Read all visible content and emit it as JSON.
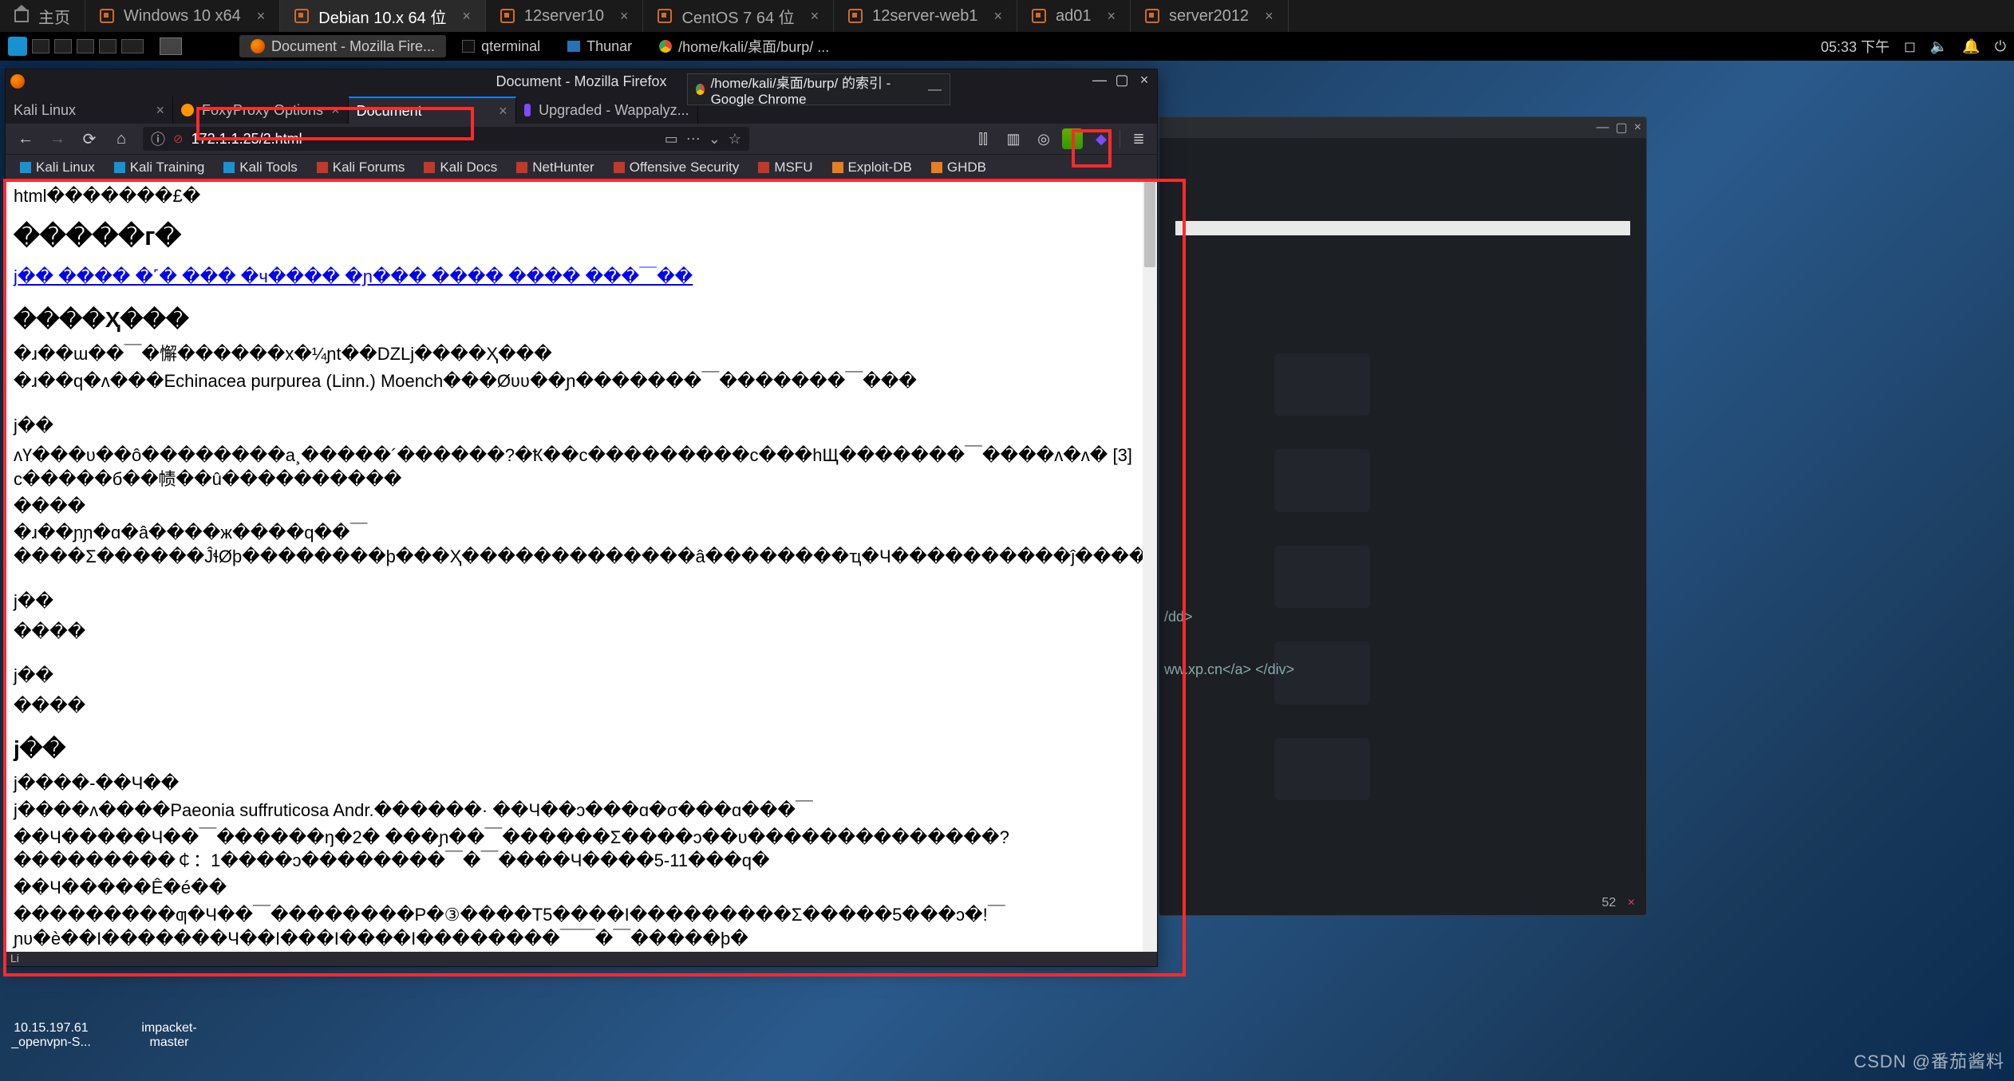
{
  "vm_tabs": {
    "home": "主页",
    "items": [
      {
        "label": "Windows 10 x64"
      },
      {
        "label": "Debian 10.x 64 位",
        "active": true
      },
      {
        "label": "12server10"
      },
      {
        "label": "CentOS 7 64 位"
      },
      {
        "label": "12server-web1"
      },
      {
        "label": "ad01"
      },
      {
        "label": "server2012"
      }
    ]
  },
  "kali_bar": {
    "apps": [
      {
        "label": "Document - Mozilla Fire...",
        "active": true,
        "icon": "firefox"
      },
      {
        "label": "qterminal",
        "icon": "terminal"
      },
      {
        "label": "Thunar",
        "icon": "files"
      },
      {
        "label": "/home/kali/桌面/burp/ ...",
        "icon": "chrome"
      }
    ],
    "clock": "05:33 下午"
  },
  "firefox": {
    "title": "Document - Mozilla Firefox",
    "tabs": [
      {
        "label": "Kali Linux"
      },
      {
        "label": "FoxyProxy Options",
        "icon": "fp"
      },
      {
        "label": "Document",
        "active": true
      },
      {
        "label": "Upgraded - Wappalyz...",
        "icon": "wapp"
      }
    ],
    "url_protocol_hint": "ⓘ",
    "url": "172.1.1.25/2.html",
    "bookmarks": [
      {
        "label": "Kali Linux",
        "cls": "bic-kali"
      },
      {
        "label": "Kali Training",
        "cls": "bic-kt"
      },
      {
        "label": "Kali Tools",
        "cls": "bic-kt"
      },
      {
        "label": "Kali Forums",
        "cls": "bic-fs"
      },
      {
        "label": "Kali Docs",
        "cls": "bic-kd"
      },
      {
        "label": "NetHunter",
        "cls": "bic-nh"
      },
      {
        "label": "Offensive Security",
        "cls": "bic-off"
      },
      {
        "label": "MSFU",
        "cls": "bic-msf"
      },
      {
        "label": "Exploit-DB",
        "cls": "bic-edb"
      },
      {
        "label": "GHDB",
        "cls": "bic-gh"
      }
    ],
    "status_char": "Li"
  },
  "chrome_overlay": {
    "title": "/home/kali/桌面/burp/ 的索引 - Google Chrome"
  },
  "page": {
    "line1": "html�������£�",
    "h1": "�����г�",
    "link": "j�� ���� �˹� ��� �ч���� �ɲ��� ���� ���� ���￣��",
    "h2a": "����Ҳ���",
    "p2": "�ɹ��ɯ��￣�懈������x�¼ɲt��DZLj����Ҳ���",
    "p3": "�ɹ��q�ʌ���Echinacea purpurea (Linn.) Moench���Øʋʋ��ɲ�������￣�������￣���",
    "blk1_a": "j��",
    "blk1_b": "ʌҮ���ʋ��ô��������a¸�����´������?�Ҟ��c���������c���hЩ�������￣����ʌ�ʌ� [3] c�����б��帻��û����������",
    "blk1_c": "����",
    "blk2": "�ɹ��ɲɲ�ɑ�â����ж����q��￣����Ʃ������ĴɬØþ��������þ���Ҳ�������������â��������ҵ�Ч����������ĵ������Σ�бô�",
    "blk3_a": "j��",
    "blk3_b": "����",
    "blk4_a": "j��",
    "blk4_b": "����",
    "h2c": "j��",
    "p5": "j����-��Ч��",
    "p6": "j����ʌ����Paeonia suffruticosa Andr.������· ��Ч��ɔ���ɑ�σ���ɑ���￣",
    "p7": "��Ч�����Ч��￣������ŋ�2� ���ɲ��￣������Σ����ɔ��ʋ��������������?���������￠：1����ɔ��������￣�￣����Ч����5-11���q�",
    "p8": "��Ч�����Ê�é��",
    "p9": "���������ƣ�Ч��￣��������Ρ�③����T5����І���������Σ�����5���ɔ�!￣ ɲʋ�è��І�������Ч��Ι���Ι����Ι��������￣￣�￣�����þ�"
  },
  "bg_window": {
    "snippet1": "/dd>",
    "snippet2": "ww.xp.cn</a> </div>",
    "footer_pos": "52",
    "footer_x": "×"
  },
  "desk": {
    "i1a": "10.15.197.61",
    "i1b": "_openvpn-S...",
    "i2a": "impacket-",
    "i2b": "master"
  },
  "watermark": "CSDN @番茄酱料"
}
